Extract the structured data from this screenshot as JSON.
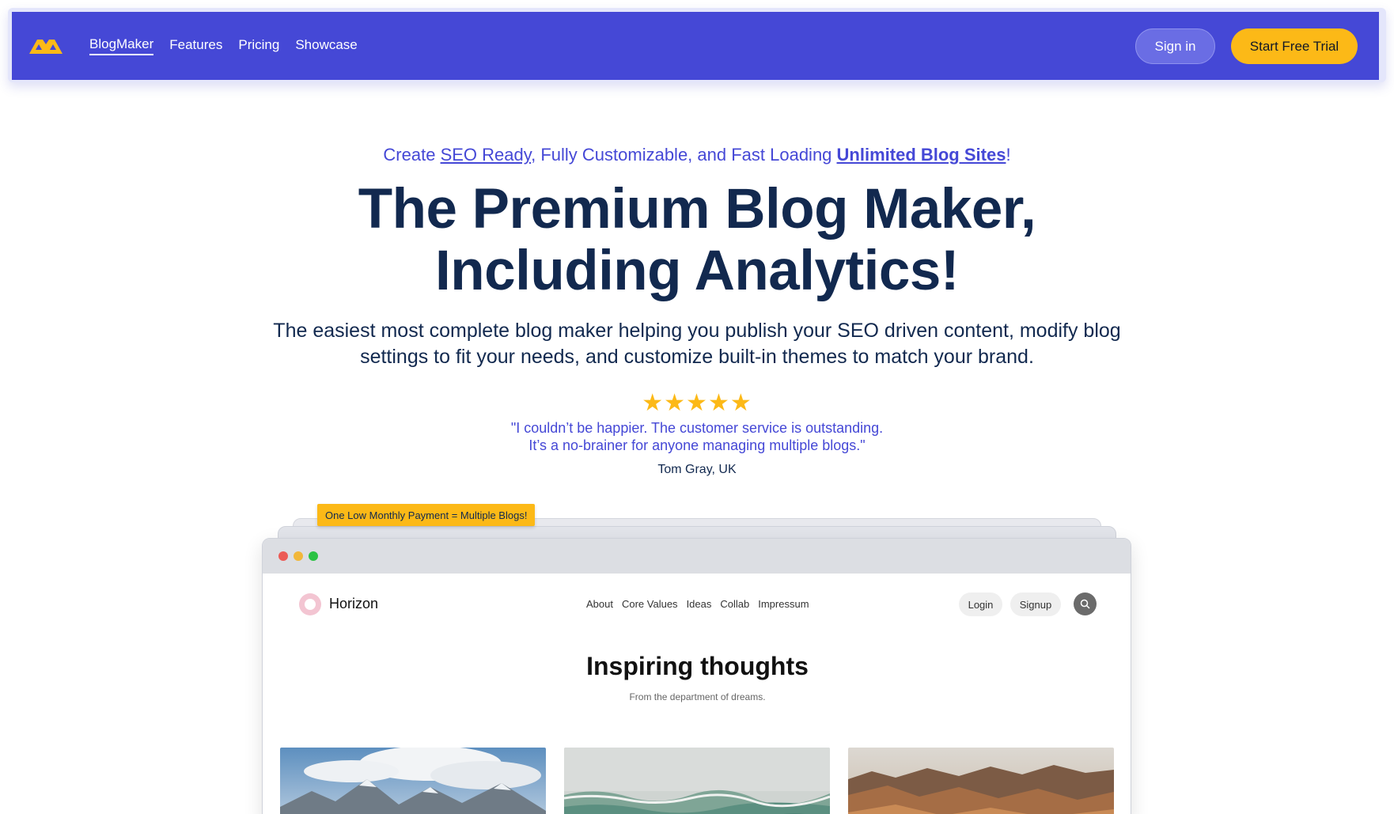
{
  "nav": {
    "logo_icon": "blogmaker-logo-icon",
    "links": [
      "BlogMaker",
      "Features",
      "Pricing",
      "Showcase"
    ],
    "signin_label": "Sign in",
    "trial_label": "Start Free Trial",
    "brand_color": "#4548d6",
    "accent_color": "#fcb917"
  },
  "hero": {
    "tagline_prefix": "Create ",
    "tagline_link1": "SEO Ready",
    "tagline_middle": ", Fully Customizable, and Fast Loading ",
    "tagline_link2": "Unlimited Blog Sites",
    "tagline_suffix": "!",
    "headline_line1": "The Premium Blog Maker,",
    "headline_line2": "Including Analytics!",
    "subhead": "The easiest most complete blog maker helping you publish your SEO driven content, modify blog settings to fit your needs, and customize built-in themes to match your brand.",
    "rating": 5,
    "quote_line1": "\"I couldn’t be happier. The customer service is outstanding.",
    "quote_line2": "It’s a no-brainer for anyone managing multiple blogs.\"",
    "author": "Tom Gray, UK"
  },
  "preview": {
    "badge": "One Low Monthly Payment = Multiple Blogs!",
    "window_dots": [
      "#ec5b56",
      "#f1b73a",
      "#2bc244"
    ],
    "site": {
      "name": "Horizon",
      "links": [
        "About",
        "Core Values",
        "Ideas",
        "Collab",
        "Impressum"
      ],
      "login_label": "Login",
      "signup_label": "Signup",
      "search_icon": "search-icon",
      "title": "Inspiring thoughts",
      "subtitle": "From the department of dreams."
    },
    "cards": [
      "mountain-landscape-image",
      "ocean-waves-image",
      "desert-canyon-image"
    ]
  }
}
